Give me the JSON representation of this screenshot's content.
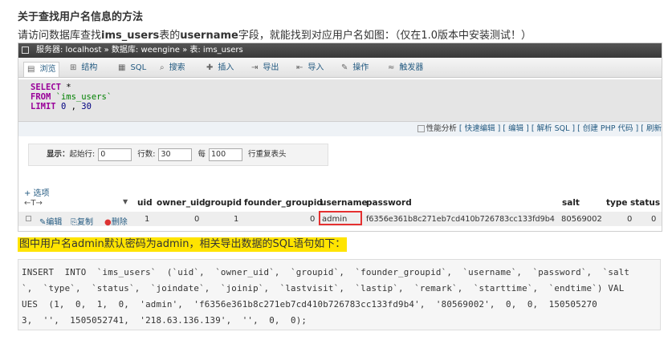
{
  "heading": "关于查找用户名信息的方法",
  "intro": {
    "pre": "请访问数据库查找",
    "table": "ims_users",
    "mid": "表的",
    "field": "username",
    "post": "字段，就能找到对应用户名如图：（仅在1.0版本中安装测试！）"
  },
  "breadcrumb": "服务器: localhost » 数据库: weengine » 表: ims_users",
  "tabs": [
    "浏览",
    "结构",
    "SQL",
    "搜索",
    "插入",
    "导出",
    "导入",
    "操作",
    "触发器"
  ],
  "sql": {
    "select": "SELECT",
    "star": "*",
    "from": "FROM",
    "table": "`ims_users`",
    "limit": "LIMIT",
    "offset": "0",
    "comma": ",",
    "count": "30"
  },
  "links": {
    "profiling": "性能分析",
    "items": "[ 快速编辑 ] [ 编辑 ] [ 解析 SQL ] [ 创建 PHP 代码 ] [ 刷新"
  },
  "nav": {
    "show": "显示：",
    "start_label": "起始行:",
    "start": "0",
    "rows_label": "行数:",
    "rows": "30",
    "every_label": "每",
    "every": "100",
    "repeat_label": "行重复表头"
  },
  "options_link": "+ 选项",
  "sort_arrows": "←T→",
  "columns": [
    "uid",
    "owner_uid",
    "groupid",
    "founder_groupid",
    "username",
    "password",
    "salt",
    "type",
    "status"
  ],
  "row": {
    "edit": "编辑",
    "copy": "复制",
    "delete": "删除",
    "uid": "1",
    "owner_uid": "0",
    "groupid": "1",
    "founder_groupid": "0",
    "username": "admin",
    "password": "f6356e361b8c271eb7cd410b726783cc133fd9b4",
    "salt": "80569002",
    "type": "0",
    "status": "0"
  },
  "note": "图中用户名admin默认密码为admin，相关导出数据的SQL语句如下：",
  "code_lines": [
    "INSERT  INTO  `ims_users`  (`uid`,  `owner_uid`,  `groupid`,  `founder_groupid`,  `username`,  `password`,  `salt",
    "`,  `type`,  `status`,  `joindate`,  `joinip`,  `lastvisit`,  `lastip`,  `remark`,  `starttime`,  `endtime`) VAL",
    "UES  (1,  0,  1,  0,  'admin',  'f6356e361b8c271eb7cd410b726783cc133fd9b4',  '80569002',  0,  0,  150505270",
    "3,  '',  1505052741,  '218.63.136.139',  '',  0,  0);"
  ],
  "colors": {
    "highlight": "#ffe400",
    "red_box": "#e53030",
    "link": "#235a81",
    "sql_keyword": "#990099"
  }
}
